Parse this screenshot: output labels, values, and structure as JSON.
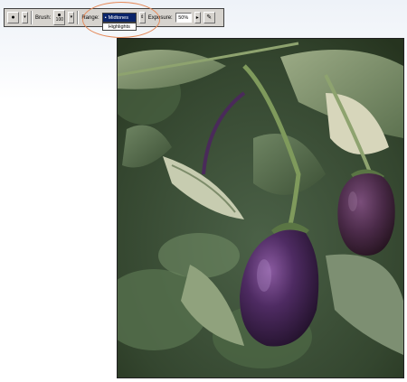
{
  "toolbar": {
    "brush_label": "Brush:",
    "brush_size": "100",
    "range_label": "Range:",
    "range_selected": "Midtones",
    "range_option_highlights": "Highlights",
    "exposure_label": "Exposure:",
    "exposure_value": "50%"
  },
  "icons": {
    "tool": "dodge-tool-icon",
    "airbrush": "airbrush-icon"
  },
  "colors": {
    "toolbar_bg": "#d6d3ce",
    "selection_blue": "#0a246a",
    "highlight_ring": "#e58a5a",
    "eggplant": "#4a2a5a"
  }
}
